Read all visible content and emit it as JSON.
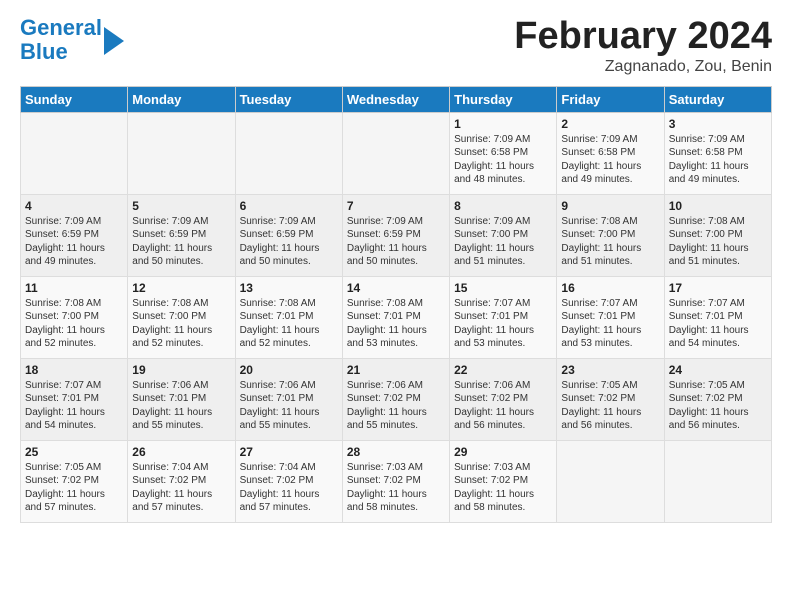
{
  "header": {
    "logo_line1": "General",
    "logo_line2": "Blue",
    "month_title": "February 2024",
    "location": "Zagnanado, Zou, Benin"
  },
  "days_of_week": [
    "Sunday",
    "Monday",
    "Tuesday",
    "Wednesday",
    "Thursday",
    "Friday",
    "Saturday"
  ],
  "weeks": [
    [
      {
        "day": "",
        "info": ""
      },
      {
        "day": "",
        "info": ""
      },
      {
        "day": "",
        "info": ""
      },
      {
        "day": "",
        "info": ""
      },
      {
        "day": "1",
        "info": "Sunrise: 7:09 AM\nSunset: 6:58 PM\nDaylight: 11 hours\nand 48 minutes."
      },
      {
        "day": "2",
        "info": "Sunrise: 7:09 AM\nSunset: 6:58 PM\nDaylight: 11 hours\nand 49 minutes."
      },
      {
        "day": "3",
        "info": "Sunrise: 7:09 AM\nSunset: 6:58 PM\nDaylight: 11 hours\nand 49 minutes."
      }
    ],
    [
      {
        "day": "4",
        "info": "Sunrise: 7:09 AM\nSunset: 6:59 PM\nDaylight: 11 hours\nand 49 minutes."
      },
      {
        "day": "5",
        "info": "Sunrise: 7:09 AM\nSunset: 6:59 PM\nDaylight: 11 hours\nand 50 minutes."
      },
      {
        "day": "6",
        "info": "Sunrise: 7:09 AM\nSunset: 6:59 PM\nDaylight: 11 hours\nand 50 minutes."
      },
      {
        "day": "7",
        "info": "Sunrise: 7:09 AM\nSunset: 6:59 PM\nDaylight: 11 hours\nand 50 minutes."
      },
      {
        "day": "8",
        "info": "Sunrise: 7:09 AM\nSunset: 7:00 PM\nDaylight: 11 hours\nand 51 minutes."
      },
      {
        "day": "9",
        "info": "Sunrise: 7:08 AM\nSunset: 7:00 PM\nDaylight: 11 hours\nand 51 minutes."
      },
      {
        "day": "10",
        "info": "Sunrise: 7:08 AM\nSunset: 7:00 PM\nDaylight: 11 hours\nand 51 minutes."
      }
    ],
    [
      {
        "day": "11",
        "info": "Sunrise: 7:08 AM\nSunset: 7:00 PM\nDaylight: 11 hours\nand 52 minutes."
      },
      {
        "day": "12",
        "info": "Sunrise: 7:08 AM\nSunset: 7:00 PM\nDaylight: 11 hours\nand 52 minutes."
      },
      {
        "day": "13",
        "info": "Sunrise: 7:08 AM\nSunset: 7:01 PM\nDaylight: 11 hours\nand 52 minutes."
      },
      {
        "day": "14",
        "info": "Sunrise: 7:08 AM\nSunset: 7:01 PM\nDaylight: 11 hours\nand 53 minutes."
      },
      {
        "day": "15",
        "info": "Sunrise: 7:07 AM\nSunset: 7:01 PM\nDaylight: 11 hours\nand 53 minutes."
      },
      {
        "day": "16",
        "info": "Sunrise: 7:07 AM\nSunset: 7:01 PM\nDaylight: 11 hours\nand 53 minutes."
      },
      {
        "day": "17",
        "info": "Sunrise: 7:07 AM\nSunset: 7:01 PM\nDaylight: 11 hours\nand 54 minutes."
      }
    ],
    [
      {
        "day": "18",
        "info": "Sunrise: 7:07 AM\nSunset: 7:01 PM\nDaylight: 11 hours\nand 54 minutes."
      },
      {
        "day": "19",
        "info": "Sunrise: 7:06 AM\nSunset: 7:01 PM\nDaylight: 11 hours\nand 55 minutes."
      },
      {
        "day": "20",
        "info": "Sunrise: 7:06 AM\nSunset: 7:01 PM\nDaylight: 11 hours\nand 55 minutes."
      },
      {
        "day": "21",
        "info": "Sunrise: 7:06 AM\nSunset: 7:02 PM\nDaylight: 11 hours\nand 55 minutes."
      },
      {
        "day": "22",
        "info": "Sunrise: 7:06 AM\nSunset: 7:02 PM\nDaylight: 11 hours\nand 56 minutes."
      },
      {
        "day": "23",
        "info": "Sunrise: 7:05 AM\nSunset: 7:02 PM\nDaylight: 11 hours\nand 56 minutes."
      },
      {
        "day": "24",
        "info": "Sunrise: 7:05 AM\nSunset: 7:02 PM\nDaylight: 11 hours\nand 56 minutes."
      }
    ],
    [
      {
        "day": "25",
        "info": "Sunrise: 7:05 AM\nSunset: 7:02 PM\nDaylight: 11 hours\nand 57 minutes."
      },
      {
        "day": "26",
        "info": "Sunrise: 7:04 AM\nSunset: 7:02 PM\nDaylight: 11 hours\nand 57 minutes."
      },
      {
        "day": "27",
        "info": "Sunrise: 7:04 AM\nSunset: 7:02 PM\nDaylight: 11 hours\nand 57 minutes."
      },
      {
        "day": "28",
        "info": "Sunrise: 7:03 AM\nSunset: 7:02 PM\nDaylight: 11 hours\nand 58 minutes."
      },
      {
        "day": "29",
        "info": "Sunrise: 7:03 AM\nSunset: 7:02 PM\nDaylight: 11 hours\nand 58 minutes."
      },
      {
        "day": "",
        "info": ""
      },
      {
        "day": "",
        "info": ""
      }
    ]
  ]
}
